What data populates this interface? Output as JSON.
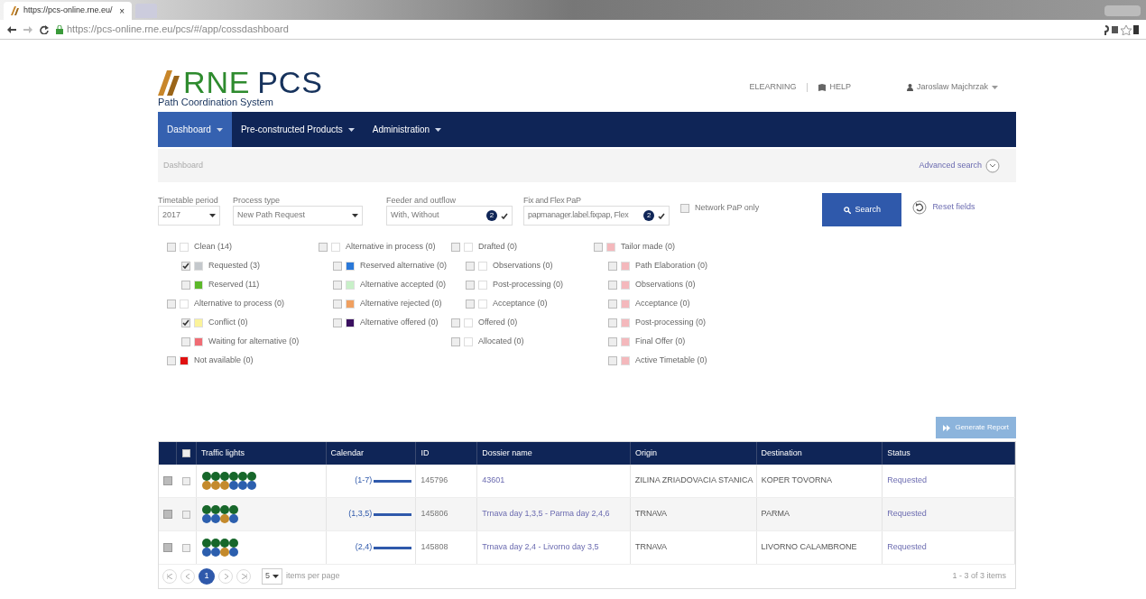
{
  "browser": {
    "tab_title": "https://pcs-online.rne.eu/",
    "tab_close": "×",
    "url": "https://pcs-online.rne.eu/pcs/#/app/cossdashboard"
  },
  "header": {
    "logo_text": "RNE",
    "logo_text_2": "PCS",
    "logo_subtitle": "Path Coordination System",
    "links": [
      "ELEARNING",
      "HELP"
    ],
    "user": "Jaroslaw Majchrzak"
  },
  "nav": [
    {
      "label": "Dashboard",
      "selected": true
    },
    {
      "label": "Pre-constructed Products",
      "selected": false
    },
    {
      "label": "Administration",
      "selected": false
    }
  ],
  "breadcrumb": "Dashboard",
  "advanced_search": "Advanced search",
  "filters": {
    "timetable_period": {
      "label": "Timetable period",
      "value": "2017"
    },
    "process_type": {
      "label": "Process type",
      "value": "New Path Request"
    },
    "feeder": {
      "label": "Feeder and outflow",
      "value": "With, Without",
      "count": "2"
    },
    "fix_flex": {
      "label": "Fix and Flex PaP",
      "value": "papmanager.label.fixpap, Flex",
      "count": "2"
    },
    "network_pap_only": {
      "label": "Network PaP only",
      "checked": false
    },
    "search_button": "Search",
    "reset": "Reset fields"
  },
  "status_tree": [
    [
      {
        "label": "Clean (14)",
        "color": "#ffffff",
        "checked": false,
        "children": [
          {
            "label": "Requested (3)",
            "color": "#c4c8cc",
            "checked": true
          },
          {
            "label": "Reserved (11)",
            "color": "#5cb82a",
            "checked": false
          }
        ]
      },
      {
        "label": "Alternative to process (0)",
        "color": "#ffffff",
        "checked": false,
        "children": [
          {
            "label": "Conflict (0)",
            "color": "#fbf39a",
            "checked": true
          },
          {
            "label": "Waiting for alternative (0)",
            "color": "#f06c74",
            "checked": false
          }
        ]
      },
      {
        "label": "Not available (0)",
        "color": "#e01010",
        "checked": false
      }
    ],
    [
      {
        "label": "Alternative in process (0)",
        "color": "#ffffff",
        "checked": false,
        "children": [
          {
            "label": "Reserved alternative (0)",
            "color": "#2a78d8",
            "checked": false
          },
          {
            "label": "Alternative accepted (0)",
            "color": "#c8f0c8",
            "checked": false
          },
          {
            "label": "Alternative rejected (0)",
            "color": "#f0a060",
            "checked": false
          },
          {
            "label": "Alternative offered (0)",
            "color": "#3a1060",
            "checked": false
          }
        ]
      }
    ],
    [
      {
        "label": "Drafted (0)",
        "color": "#ffffff",
        "checked": false,
        "children": [
          {
            "label": "Observations (0)",
            "color": "#ffffff",
            "checked": false
          },
          {
            "label": "Post-processing (0)",
            "color": "#ffffff",
            "checked": false
          },
          {
            "label": "Acceptance (0)",
            "color": "#ffffff",
            "checked": false
          }
        ]
      },
      {
        "label": "Offered (0)",
        "color": "#ffffff",
        "checked": false
      },
      {
        "label": "Allocated (0)",
        "color": "#ffffff",
        "checked": false
      }
    ],
    [
      {
        "label": "Tailor made (0)",
        "color": "#f4b8bc",
        "checked": false,
        "children": [
          {
            "label": "Path Elaboration (0)",
            "color": "#f4b8bc",
            "checked": false
          },
          {
            "label": "Observations (0)",
            "color": "#f4b8bc",
            "checked": false
          },
          {
            "label": "Acceptance (0)",
            "color": "#f4b8bc",
            "checked": false
          },
          {
            "label": "Post-processing (0)",
            "color": "#f4b8bc",
            "checked": false
          },
          {
            "label": "Final Offer (0)",
            "color": "#f4b8bc",
            "checked": false
          },
          {
            "label": "Active Timetable (0)",
            "color": "#f4b8bc",
            "checked": false
          }
        ]
      }
    ]
  ],
  "generate_report": {
    "label": "Generate Report",
    "disabled": true
  },
  "table": {
    "select_all": {
      "checked": false
    },
    "columns": [
      "Traffic lights",
      "Calendar",
      "ID",
      "Dossier name",
      "Origin",
      "Destination",
      "Status"
    ],
    "rows": [
      {
        "checked": false,
        "lights": [
          [
            {
              "color": "#17672a"
            },
            {
              "color": "#17672a"
            },
            {
              "color": "#17672a"
            },
            {
              "color": "#17672a"
            },
            {
              "color": "#17672a"
            },
            {
              "color": "#17672a"
            }
          ],
          [
            {
              "color": "#c48a2c"
            },
            {
              "color": "#c48a2c"
            },
            {
              "color": "#c48a2c"
            },
            {
              "color": "#2c5fae"
            },
            {
              "color": "#2c5fae"
            },
            {
              "color": "#2c5fae"
            }
          ]
        ],
        "calendar": "(1-7)",
        "id": "145796",
        "dossier": "43601",
        "origin": "ZILINA ZRIADOVACIA STANICA",
        "destination": "KOPER TOVORNA",
        "status": "Requested"
      },
      {
        "checked": false,
        "lights": [
          [
            {
              "color": "#17672a"
            },
            {
              "color": "#17672a"
            },
            {
              "color": "#17672a"
            },
            {
              "color": "#17672a"
            }
          ],
          [
            {
              "color": "#2c5fae"
            },
            {
              "color": "#2c5fae"
            },
            {
              "color": "#c48a2c"
            },
            {
              "color": "#2c5fae"
            }
          ]
        ],
        "calendar": "(1,3,5)",
        "id": "145806",
        "dossier": "Trnava day 1,3,5 - Parma day 2,4,6",
        "origin": "TRNAVA",
        "destination": "PARMA",
        "status": "Requested"
      },
      {
        "checked": false,
        "lights": [
          [
            {
              "color": "#17672a"
            },
            {
              "color": "#17672a"
            },
            {
              "color": "#17672a"
            },
            {
              "color": "#17672a"
            }
          ],
          [
            {
              "color": "#2c5fae"
            },
            {
              "color": "#2c5fae"
            },
            {
              "color": "#c48a2c"
            },
            {
              "color": "#2c5fae"
            }
          ]
        ],
        "calendar": "(2,4)",
        "id": "145808",
        "dossier": "Trnava day 2,4 - Livorno day 3,5",
        "origin": "TRNAVA",
        "destination": "LIVORNO CALAMBRONE",
        "status": "Requested"
      }
    ]
  },
  "pagination": {
    "pages": [
      {
        "label": "1",
        "selected": true
      }
    ],
    "page_size": "5",
    "page_size_label": "items per page",
    "summary": "1 - 3 of 3 items"
  }
}
